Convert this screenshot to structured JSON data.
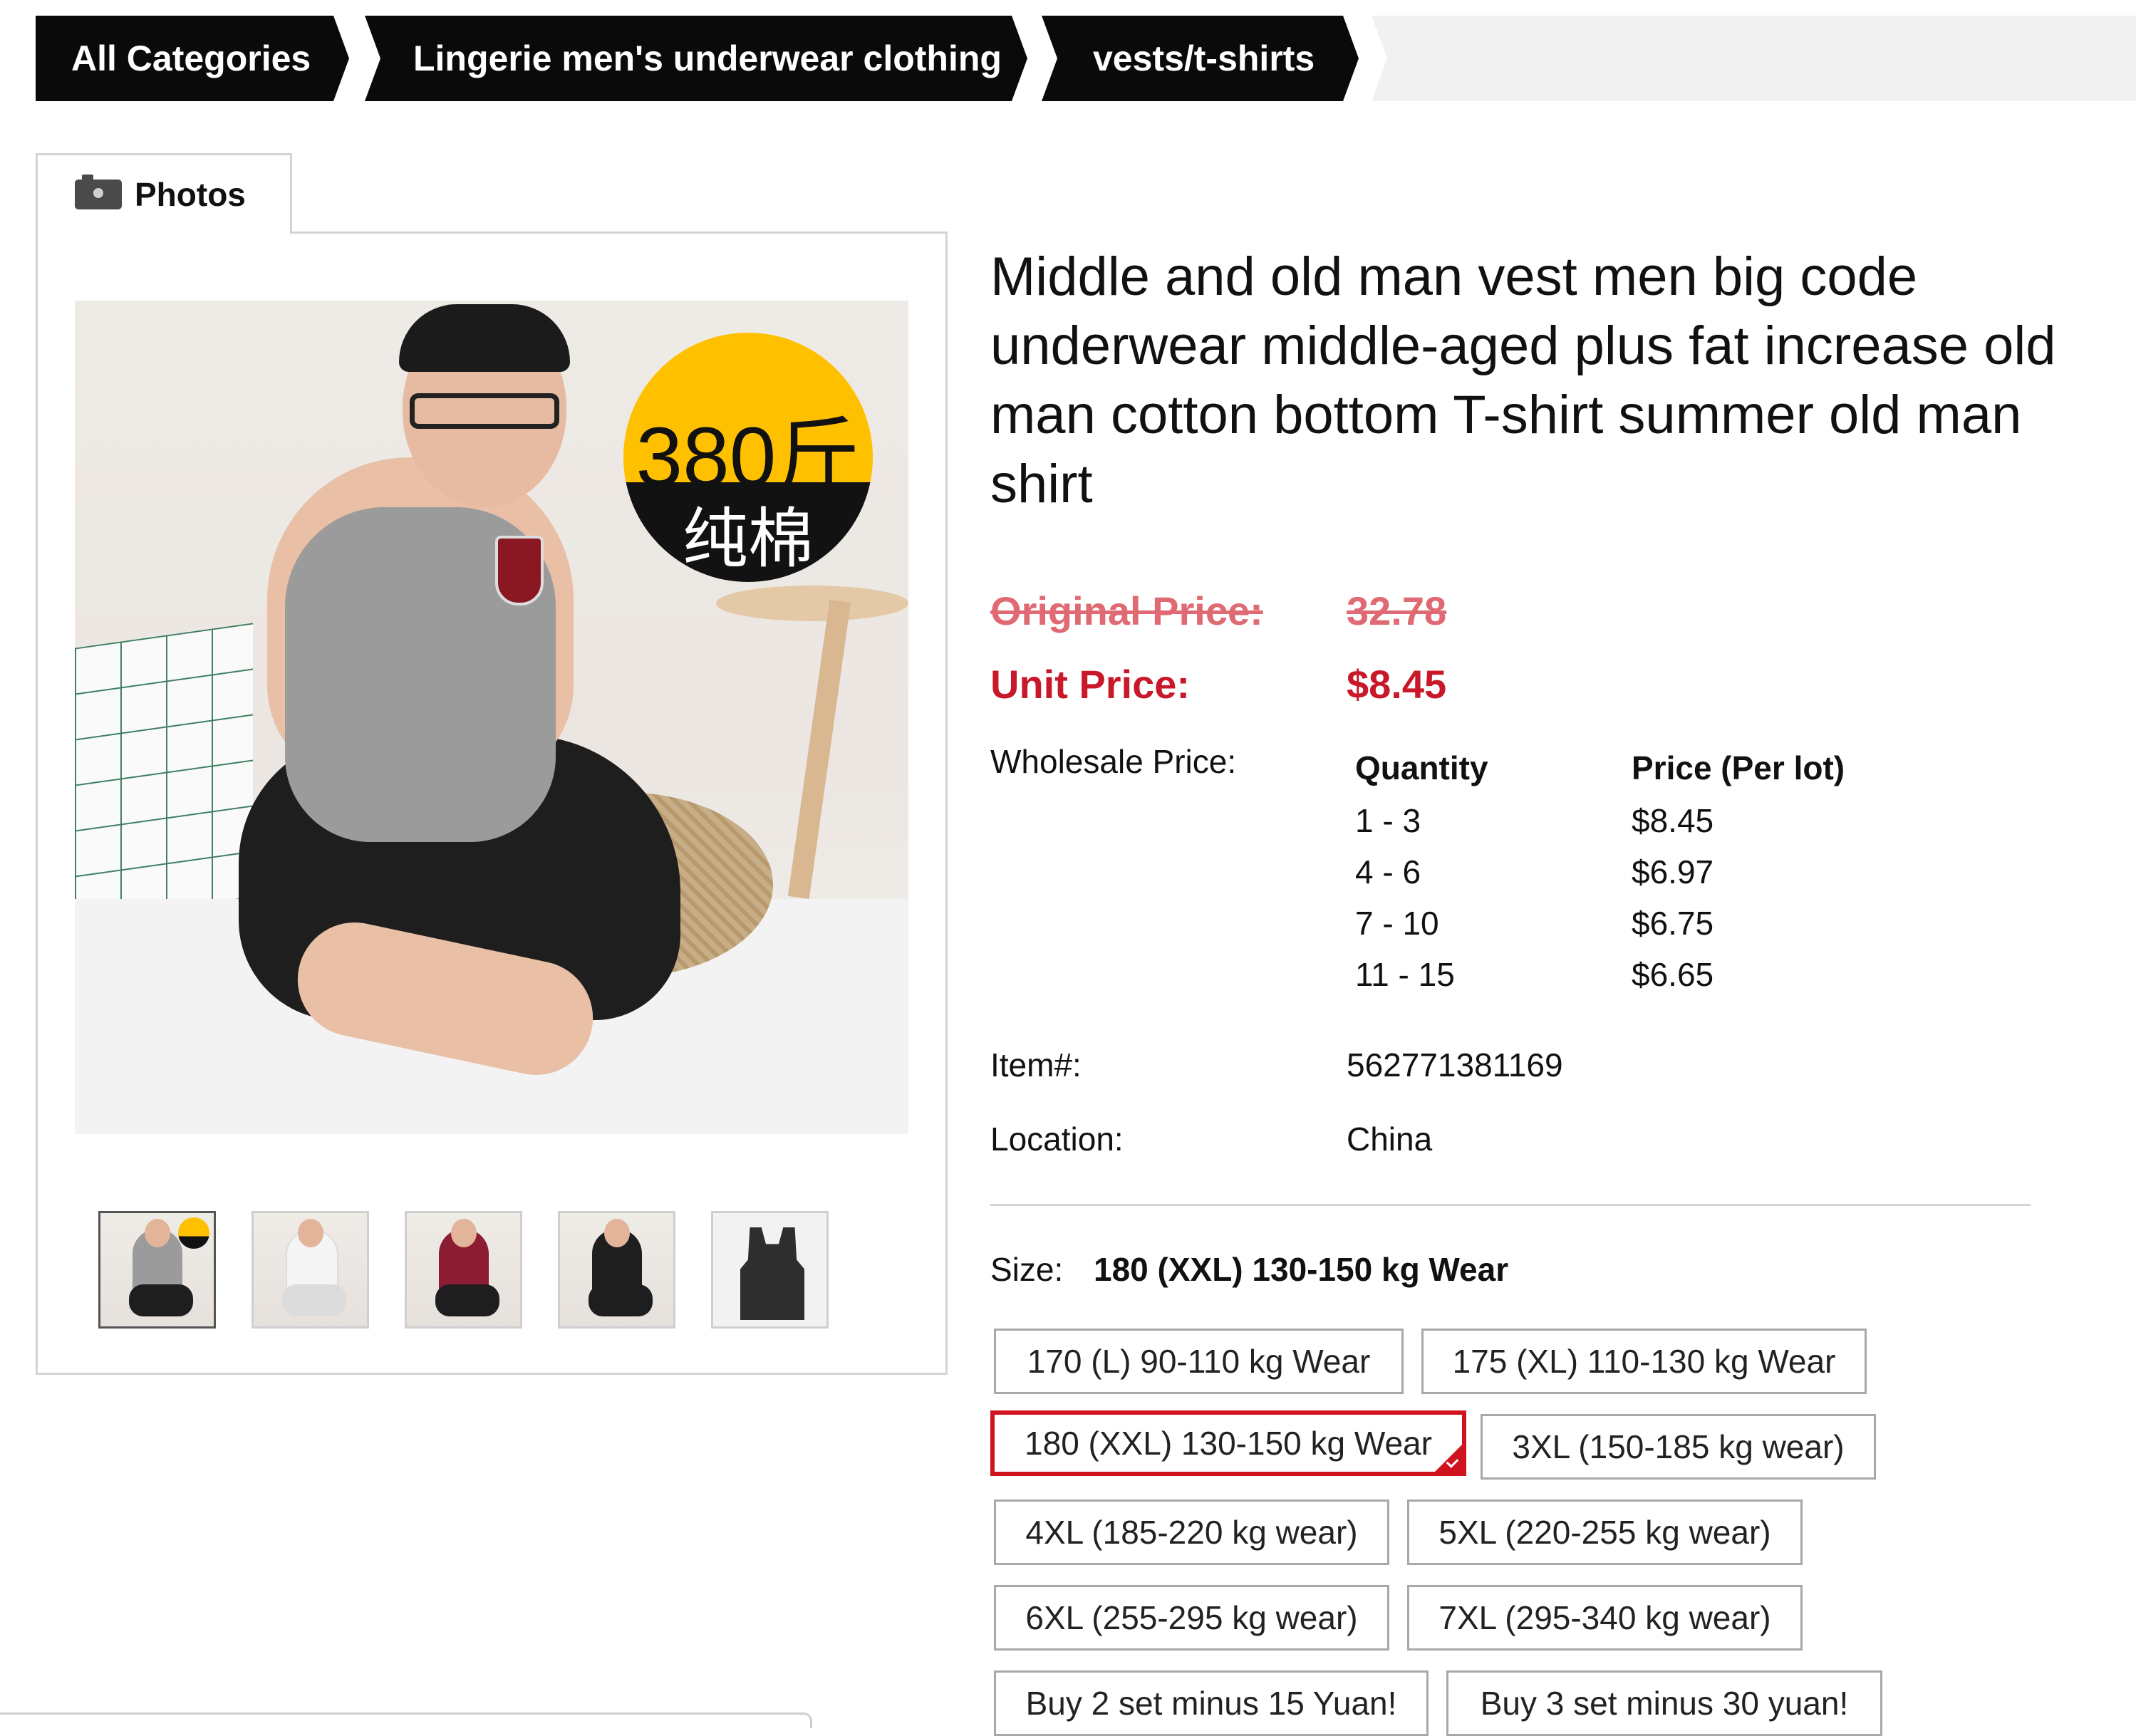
{
  "breadcrumb": {
    "items": [
      "All Categories",
      "Lingerie men's underwear clothing",
      "vests/t-shirts"
    ]
  },
  "photos": {
    "tab_label": "Photos",
    "badge_line1": "380斤",
    "badge_line2": "纯棉",
    "thumbnails": [
      "thumb-1",
      "thumb-2",
      "thumb-3",
      "thumb-4",
      "thumb-5"
    ]
  },
  "product": {
    "title": "Middle and old man vest men big code underwear middle-aged plus fat increase old man cotton bottom T-shirt summer old man shirt",
    "original_price_label": "Original Price:",
    "original_price": "32.78",
    "unit_price_label": "Unit Price:",
    "unit_price": "$8.45",
    "wholesale_label": "Wholesale Price:",
    "wholesale": {
      "headers": [
        "Quantity",
        "Price (Per lot)"
      ],
      "rows": [
        [
          "1 - 3",
          "$8.45"
        ],
        [
          "4 - 6",
          "$6.97"
        ],
        [
          "7 - 10",
          "$6.75"
        ],
        [
          "11 - 15",
          "$6.65"
        ]
      ]
    },
    "item_label": "Item#:",
    "item_value": "562771381169",
    "location_label": "Location:",
    "location_value": "China"
  },
  "size": {
    "label": "Size:",
    "selected": "180 (XXL) 130-150 kg Wear",
    "options": [
      "170 (L) 90-110 kg Wear",
      "175 (XL) 110-130 kg Wear",
      "180 (XXL) 130-150 kg Wear",
      "3XL (150-185 kg wear)",
      "4XL (185-220 kg wear)",
      "5XL (220-255 kg wear)",
      "6XL (255-295 kg wear)",
      "7XL (295-340 kg wear)",
      "Buy 2 set minus 15 Yuan!",
      "Buy 3 set minus 30 yuan!"
    ]
  },
  "colors": {
    "accent_red": "#c8182a",
    "breadcrumb_bg": "#0a0a0a",
    "badge_yellow": "#ffc000"
  }
}
